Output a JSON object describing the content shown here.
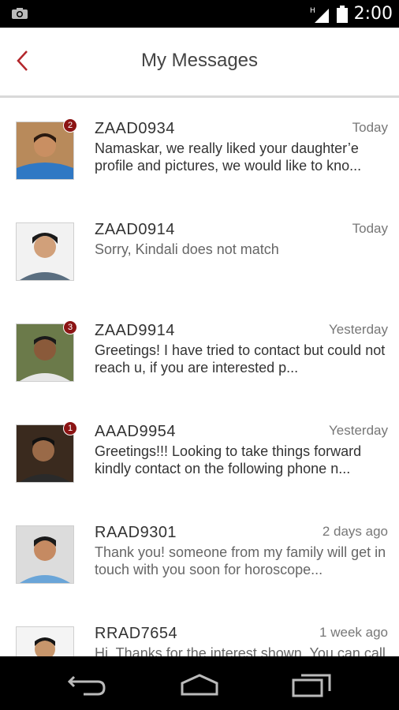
{
  "status": {
    "time": "2:00"
  },
  "header": {
    "title": "My Messages"
  },
  "messages": [
    {
      "id": "ZAAD0934",
      "time": "Today",
      "preview": "Namaskar, we really liked your daughter’e profile and pictures, we would like to kno...",
      "badge": "2"
    },
    {
      "id": "ZAAD0914",
      "time": "Today",
      "preview": "Sorry, Kindali does not match",
      "badge": ""
    },
    {
      "id": "ZAAD9914",
      "time": "Yesterday",
      "preview": "Greetings! I have tried to contact but could not reach u, if you are interested p...",
      "badge": "3"
    },
    {
      "id": "AAAD9954",
      "time": "Yesterday",
      "preview": "Greetings!!! Looking to take things forward kindly contact on the following phone n...",
      "badge": "1"
    },
    {
      "id": "RAAD9301",
      "time": "2 days ago",
      "preview": "Thank you! someone from my family will get in touch with you soon for horoscope...",
      "badge": ""
    },
    {
      "id": "RRAD7654",
      "time": "1 week ago",
      "preview": "Hi, Thanks for the interest shown. You can call",
      "badge": ""
    }
  ],
  "colors": {
    "accent": "#b3262b",
    "badge": "#8b1414"
  }
}
